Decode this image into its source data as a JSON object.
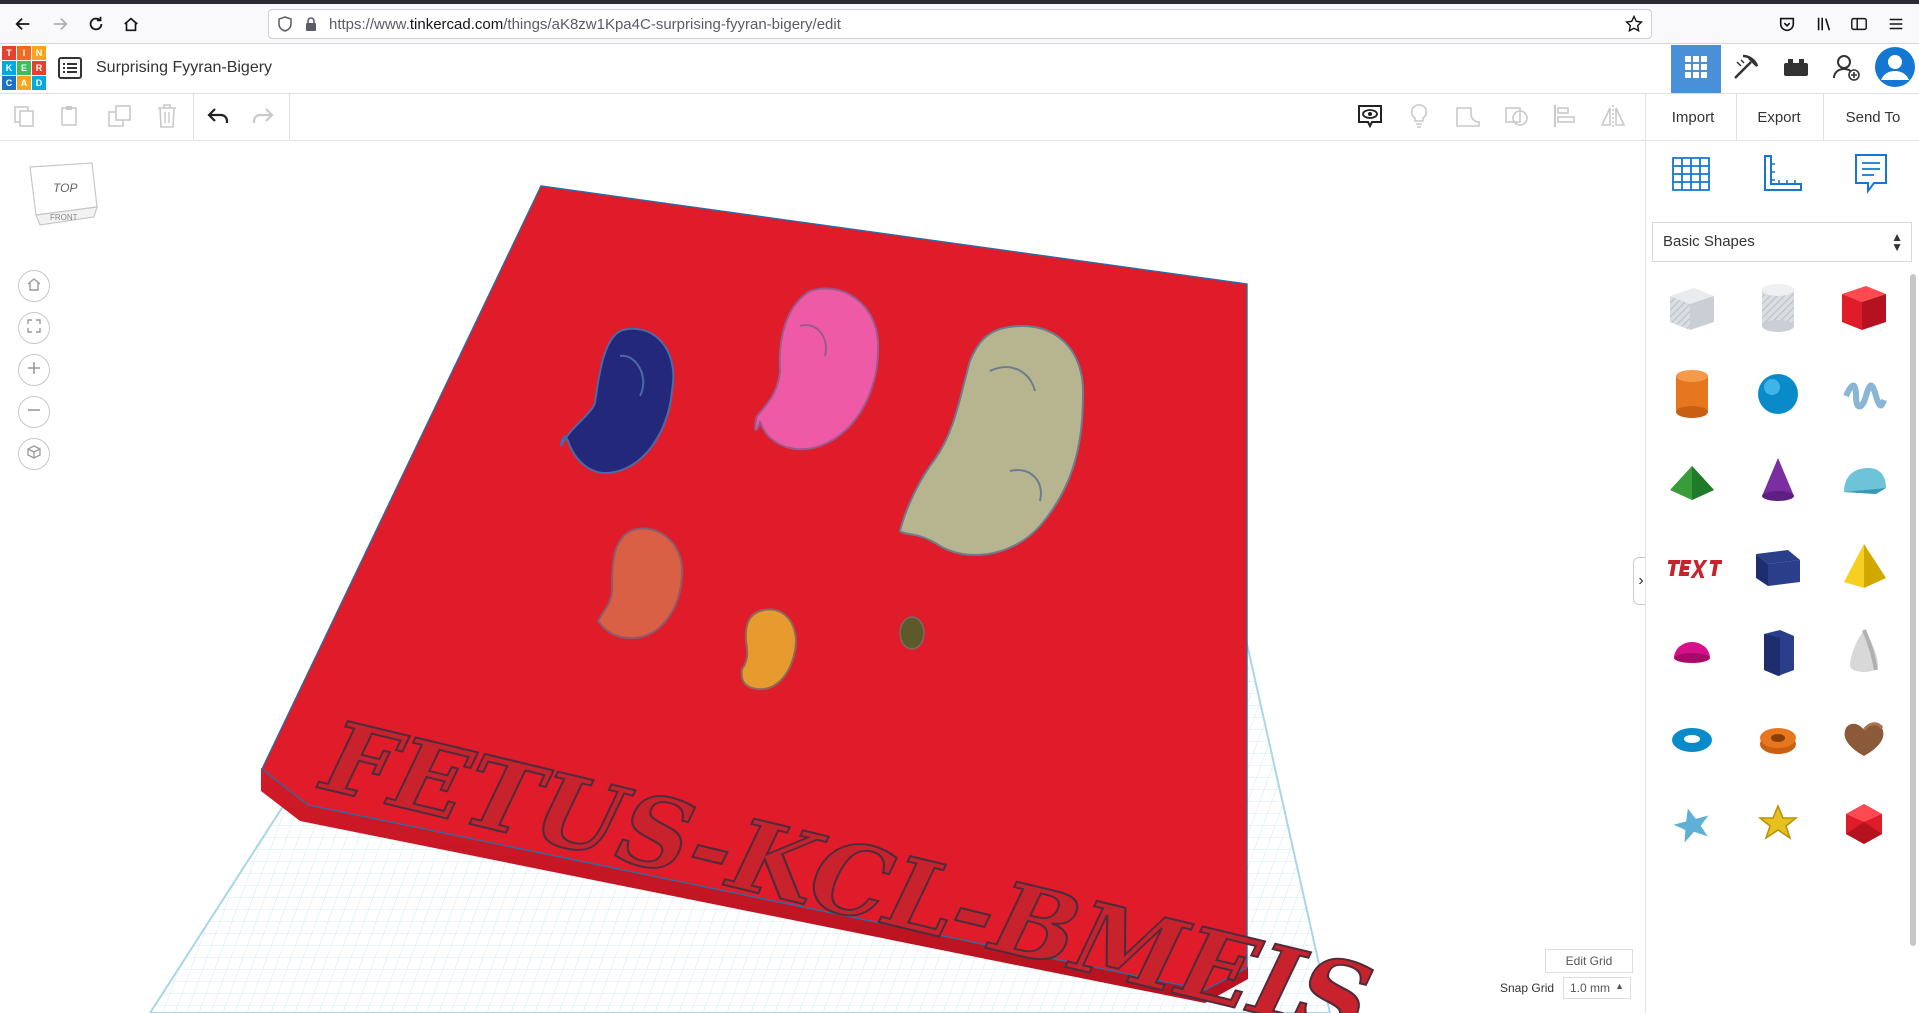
{
  "browser": {
    "url_prefix": "https://www.",
    "url_domain": "tinkercad.com",
    "url_path": "/things/aK8zw1Kpa4C-surprising-fyyran-bigery/edit"
  },
  "header": {
    "logo_letters": [
      "T",
      "I",
      "N",
      "K",
      "E",
      "R",
      "C",
      "A",
      "D"
    ],
    "logo_colors": [
      "#e6402f",
      "#f26a1f",
      "#f7a51c",
      "#00a9e0",
      "#3cbf5a",
      "#e6402f",
      "#1a73c8",
      "#f7a51c",
      "#00a9e0"
    ],
    "title": "Surprising Fyyran-Bigery"
  },
  "actions": {
    "import": "Import",
    "export": "Export",
    "send_to": "Send To"
  },
  "view_cube": {
    "top": "TOP",
    "front": "FRONT"
  },
  "scene": {
    "platform_color": "#e01b2a",
    "grid_color": "#bfe3ef",
    "embossed_text": "FETUS-KCL-BMEIS",
    "fetus_colors": [
      "#23287a",
      "#ee5aa6",
      "#b7b58f",
      "#d95f45",
      "#e79a2d",
      "#5d5a2a"
    ]
  },
  "workplane": {
    "edit_grid": "Edit Grid",
    "snap_grid_label": "Snap Grid",
    "snap_grid_value": "1.0 mm"
  },
  "panel": {
    "category": "Basic Shapes",
    "shapes": [
      "box-hole",
      "cylinder-hole",
      "box",
      "cylinder",
      "sphere",
      "scribble",
      "roof",
      "cone",
      "round-roof",
      "text",
      "wedge",
      "pyramid",
      "half-sphere",
      "polygon",
      "paraboloid",
      "torus",
      "tube",
      "heart",
      "star",
      "star-gold",
      "icosahedron"
    ]
  },
  "colors": {
    "accent_blue": "#1477d1",
    "active_tab": "#4a90d9"
  }
}
